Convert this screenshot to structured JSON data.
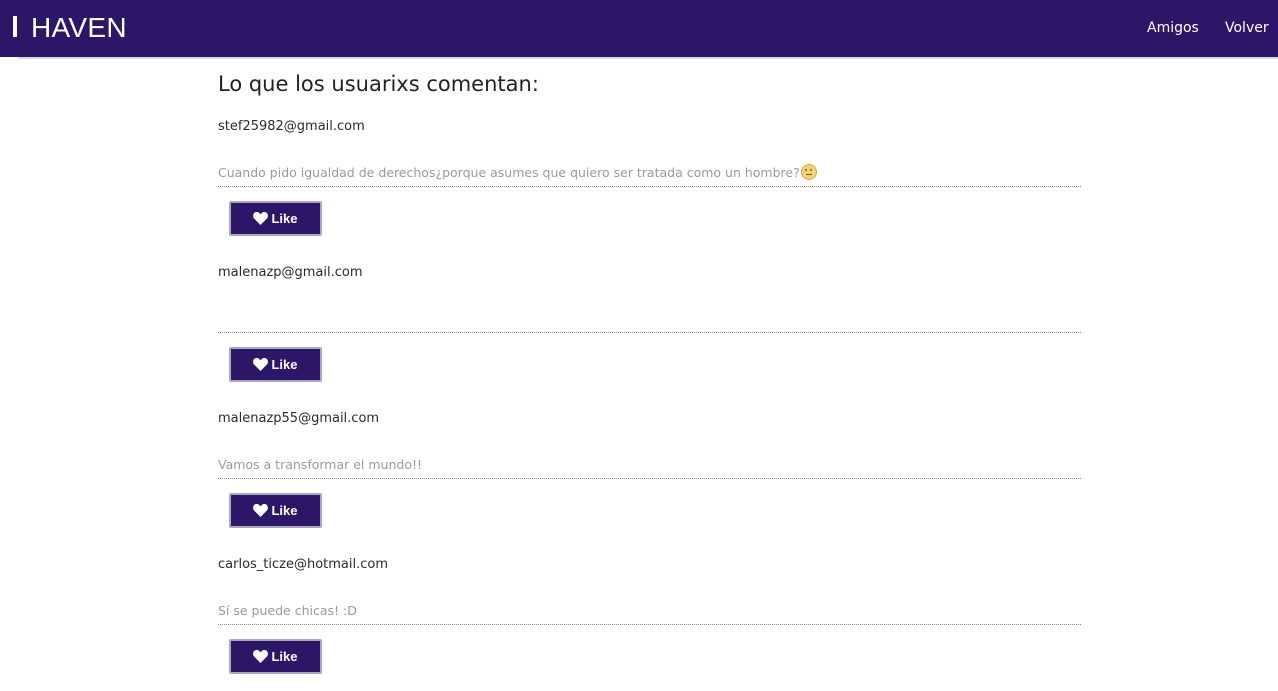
{
  "header": {
    "brand": "HAVEN",
    "nav": [
      {
        "label": "Amigos"
      },
      {
        "label": "Volver"
      }
    ]
  },
  "main": {
    "title": "Lo que los usuarixs comentan:",
    "like_label": "Like",
    "comments": [
      {
        "author": "stef25982@gmail.com",
        "text": "Cuando pido igualdad de derechos¿porque asumes que quiero ser tratada como un hombre?",
        "emoji": "neutral-face-emoji"
      },
      {
        "author": "malenazp@gmail.com",
        "text": ""
      },
      {
        "author": "malenazp55@gmail.com",
        "text": "Vamos a transformar el mundo!!"
      },
      {
        "author": "carlos_ticze@hotmail.com",
        "text": "Sí se puede chicas! :D"
      }
    ]
  },
  "colors": {
    "brand_purple": "#2d1668",
    "text_muted": "#9a9a9a",
    "button_border": "#a8a8c0"
  },
  "icons": {
    "like": "heart-icon",
    "emoji": "neutral-face-emoji"
  }
}
